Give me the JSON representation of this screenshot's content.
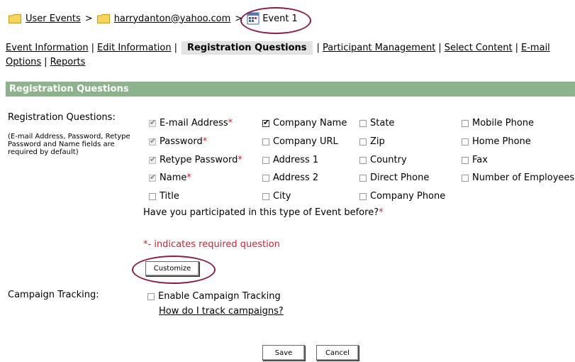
{
  "breadcrumb": {
    "root": "User Events",
    "sep1": ">",
    "user": "harrydanton@yahoo.com",
    "sep2": ">",
    "event": "Event 1"
  },
  "nav": {
    "items": [
      "Event Information",
      "Edit Information",
      "Registration Questions",
      "Participant Management",
      "Select Content",
      "E-mail Options",
      "Reports"
    ],
    "active": "Registration Questions",
    "separator": "|"
  },
  "section": {
    "title": "Registration Questions"
  },
  "questions": {
    "label": "Registration Questions:",
    "note": "(E-mail Address, Password, Retype Password and Name fields are required by default)",
    "required_mark": "*",
    "col1": [
      {
        "label": "E-mail Address",
        "checked": true,
        "disabled": true,
        "required": true
      },
      {
        "label": "Password",
        "checked": true,
        "disabled": true,
        "required": true
      },
      {
        "label": "Retype Password",
        "checked": true,
        "disabled": true,
        "required": true
      },
      {
        "label": "Name",
        "checked": true,
        "disabled": true,
        "required": true
      },
      {
        "label": "Title",
        "checked": false
      }
    ],
    "col2": [
      {
        "label": "Company Name",
        "checked": true
      },
      {
        "label": "Company URL",
        "checked": false
      },
      {
        "label": "Address 1",
        "checked": false
      },
      {
        "label": "Address 2",
        "checked": false
      },
      {
        "label": "City",
        "checked": false
      }
    ],
    "col3": [
      {
        "label": "State",
        "checked": false
      },
      {
        "label": "Zip",
        "checked": false
      },
      {
        "label": "Country",
        "checked": false
      },
      {
        "label": "Direct Phone",
        "checked": false
      },
      {
        "label": "Company Phone",
        "checked": false
      }
    ],
    "col4": [
      {
        "label": "Mobile Phone",
        "checked": false
      },
      {
        "label": "Home Phone",
        "checked": false
      },
      {
        "label": "Fax",
        "checked": false
      },
      {
        "label": "Number of Employees",
        "checked": false
      }
    ],
    "custom_question": "Have you participated in this type of Event before?",
    "required_note": "*- indicates required question",
    "customize_button": "Customize"
  },
  "campaign": {
    "label": "Campaign Tracking:",
    "checkbox_label": "Enable Campaign Tracking",
    "checked": false,
    "help_link": "How do I track campaigns?"
  },
  "footer": {
    "save": "Save",
    "cancel": "Cancel"
  },
  "colors": {
    "header_bg": "#8cb38c",
    "required": "#cc2233",
    "highlight_circle": "#8b1a4a",
    "active_tab_bg": "#e3e3e3"
  }
}
